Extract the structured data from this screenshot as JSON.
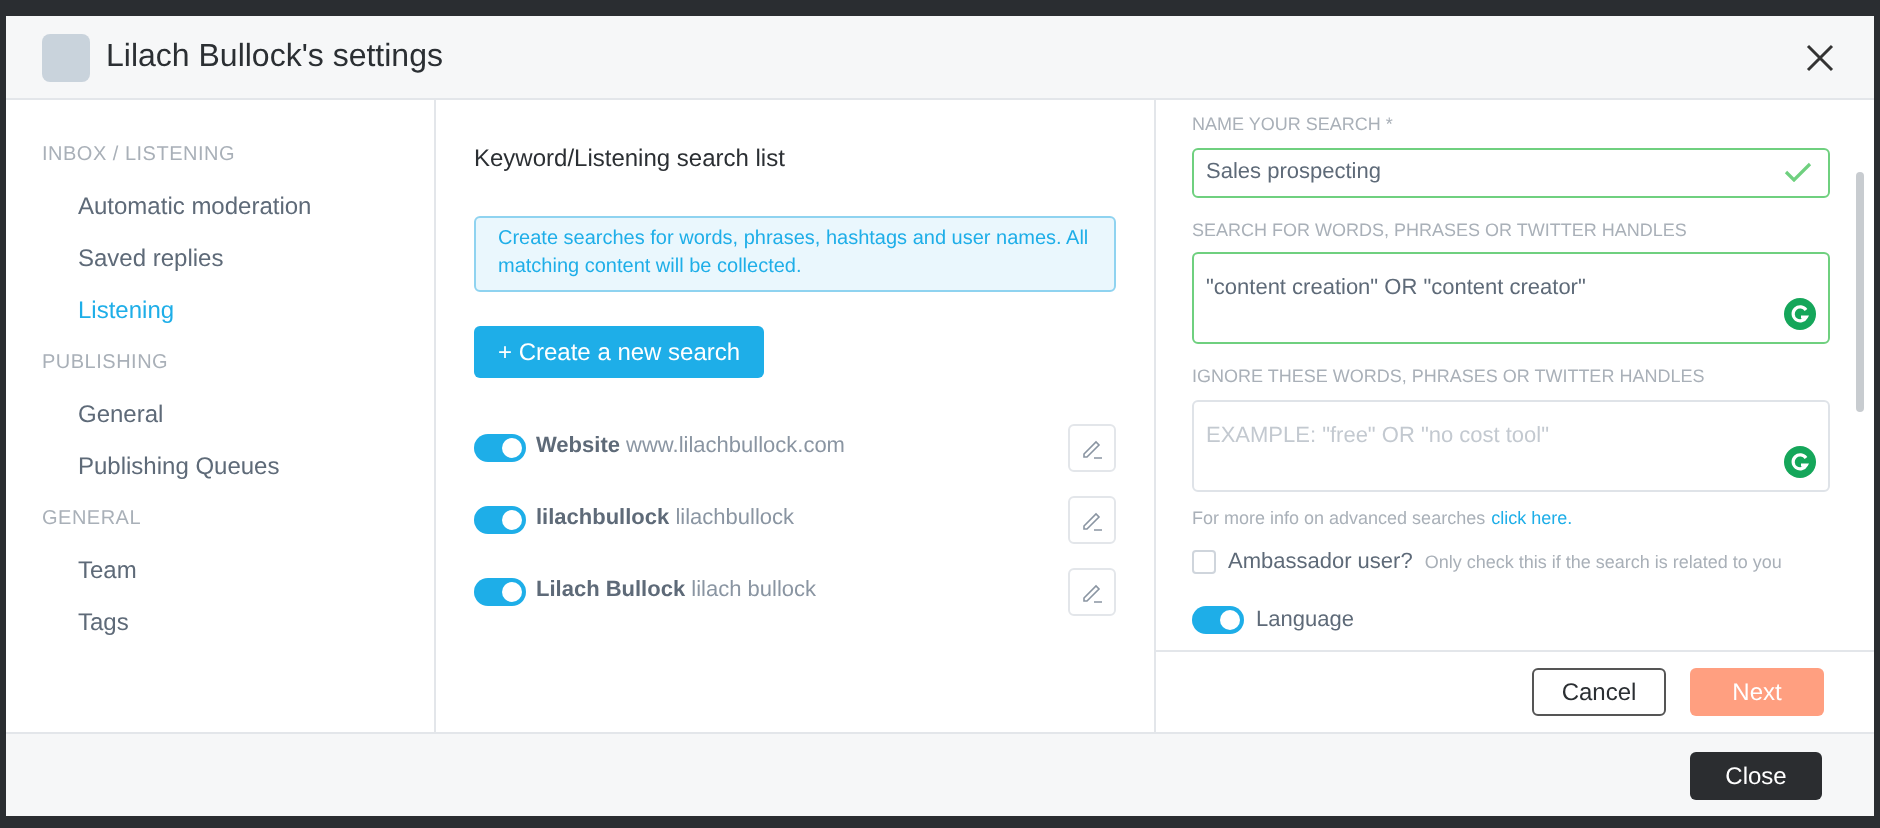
{
  "window": {
    "title": "Lilach Bullock's settings"
  },
  "sidebar": {
    "sections": [
      {
        "heading": "INBOX / LISTENING",
        "items": [
          {
            "label": "Automatic moderation",
            "selected": false
          },
          {
            "label": "Saved replies",
            "selected": false
          },
          {
            "label": "Listening",
            "selected": true
          }
        ]
      },
      {
        "heading": "PUBLISHING",
        "items": [
          {
            "label": "General",
            "selected": false
          },
          {
            "label": "Publishing Queues",
            "selected": false
          }
        ]
      },
      {
        "heading": "GENERAL",
        "items": [
          {
            "label": "Team",
            "selected": false
          },
          {
            "label": "Tags",
            "selected": false
          }
        ]
      }
    ]
  },
  "search_list": {
    "title": "Keyword/Listening search list",
    "info": "Create searches for words, phrases, hashtags and user names. All matching content will be collected.",
    "create_button": "+ Create a new search",
    "searches": [
      {
        "name": "Website",
        "query": "www.lilachbullock.com",
        "on": true
      },
      {
        "name": "lilachbullock",
        "query": "lilachbullock",
        "on": true
      },
      {
        "name": "Lilach Bullock",
        "query": "lilach bullock",
        "on": true
      }
    ]
  },
  "form": {
    "name_label": "NAME YOUR SEARCH *",
    "name_value": "Sales prospecting",
    "name_valid": true,
    "search_label": "SEARCH FOR WORDS, PHRASES OR TWITTER HANDLES",
    "search_value": "\"content creation\" OR \"content creator\"",
    "ignore_label": "IGNORE THESE WORDS, PHRASES OR TWITTER HANDLES",
    "ignore_placeholder": "EXAMPLE: \"free\" OR \"no cost tool\"",
    "help_text": "For more info on advanced searches",
    "help_link": "click here.",
    "ambassador": {
      "label": "Ambassador user?",
      "hint": "Only check this if the search is related to you",
      "checked": false
    },
    "language": {
      "label": "Language",
      "on": true
    },
    "cancel": "Cancel",
    "next": "Next"
  },
  "footer": {
    "close": "Close"
  }
}
